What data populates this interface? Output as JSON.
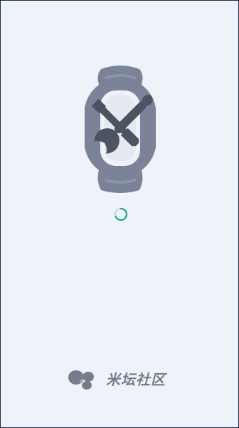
{
  "screen": {
    "background": "#eef2f9",
    "border_color": "#1f2a44"
  },
  "hero": {
    "icon": "watch-wrench-icon",
    "watch_color": "#7a8398",
    "tool_color": "#4c5361"
  },
  "loading": {
    "icon": "spinner-icon",
    "color": "#18a58d",
    "track_color": "#c8d2d8"
  },
  "brand": {
    "icon": "mitan-logo-icon",
    "name": "米坛社区",
    "color": "#757d8c"
  }
}
